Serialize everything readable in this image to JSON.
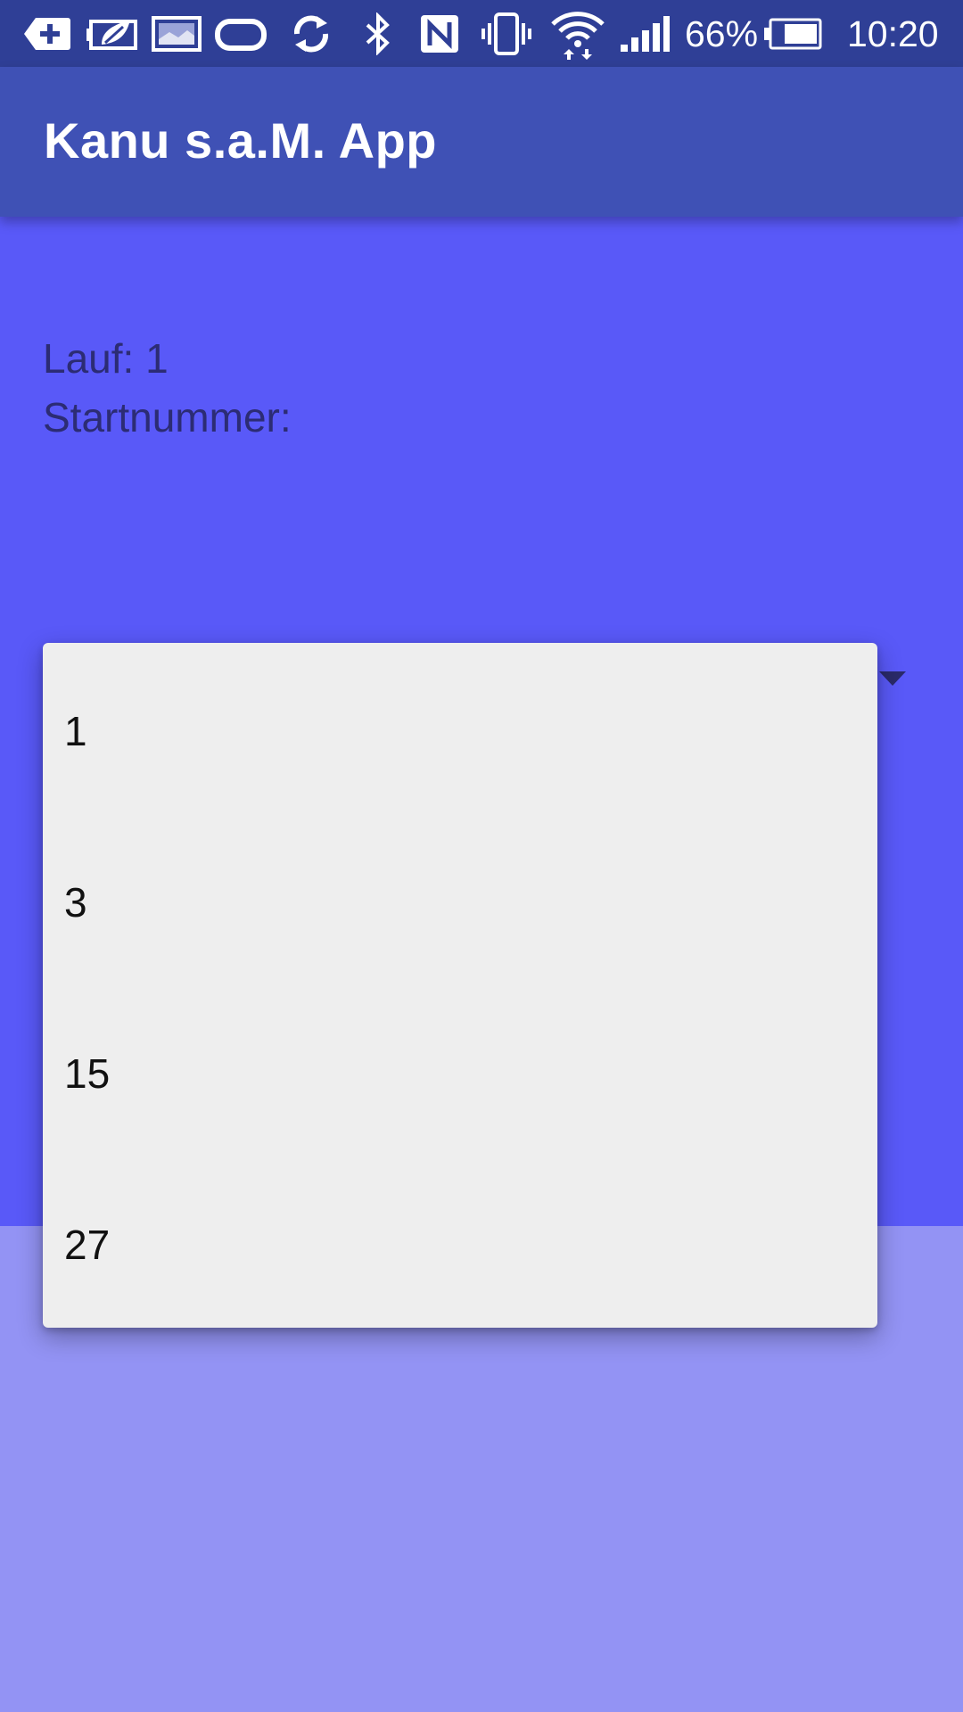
{
  "status_bar": {
    "icons": [
      "backspace-plus-icon",
      "battery-saver-leaf-icon",
      "image-gallery-icon",
      "rounded-rect-icon",
      "sync-icon",
      "bluetooth-icon",
      "nfc-icon",
      "vibrate-icon",
      "wifi-transfer-icon",
      "cellular-signal-icon",
      "battery-icon"
    ],
    "battery_percent": "66%",
    "time": "10:20"
  },
  "app_bar": {
    "title": "Kanu s.a.M. App"
  },
  "info": {
    "lauf": "Lauf: 1",
    "startnummer": "Startnummer:"
  },
  "dropdown": {
    "options": [
      "1",
      "3",
      "15",
      "27"
    ]
  },
  "colors": {
    "status_bar": "#2f3f96",
    "app_bar": "#3f51b5",
    "content_top": "#5959f8",
    "content_bottom": "#9393f4",
    "dropdown_bg": "#eeeeee",
    "info_text": "#2c2c74"
  }
}
